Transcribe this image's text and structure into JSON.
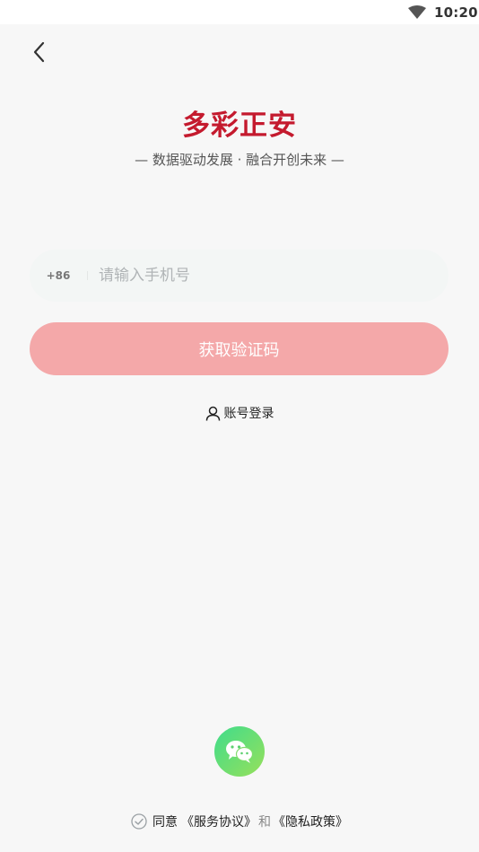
{
  "status_bar": {
    "time": "10:20",
    "wifi_icon": "wifi-icon"
  },
  "nav": {
    "back_icon": "chevron-left-icon"
  },
  "header": {
    "title": "多彩正安",
    "slogan": "— 数据驱动发展 · 融合开创未来 —",
    "brand_color": "#c41a2e"
  },
  "login_form": {
    "country_code": "+86",
    "phone_placeholder": "请输入手机号",
    "phone_value": "",
    "get_code_label": "获取验证码",
    "button_color": "#f4a8a9"
  },
  "account_login": {
    "icon": "user-icon",
    "label": "账号登录"
  },
  "third_party": {
    "wechat_icon": "wechat-icon"
  },
  "agreement": {
    "check_icon": "check-circle-icon",
    "prefix": "同意",
    "terms": "《服务协议》",
    "conjunction": "和",
    "privacy": "《隐私政策》"
  }
}
